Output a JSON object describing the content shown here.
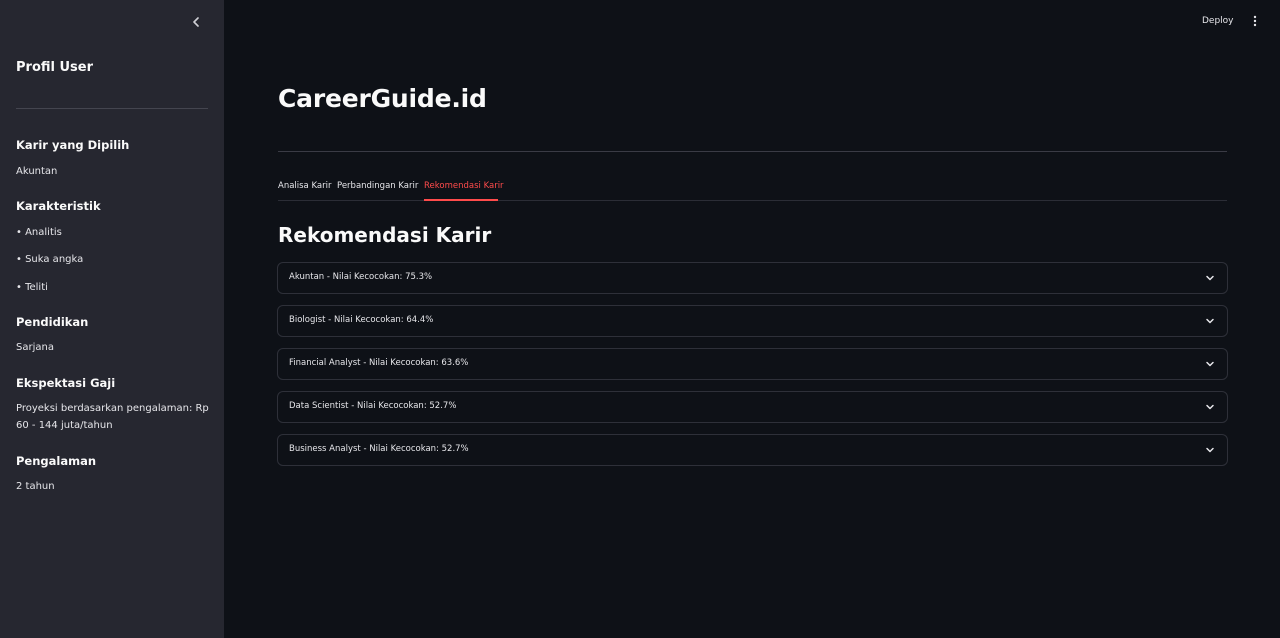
{
  "sidebar": {
    "title": "Profil User",
    "sections": [
      {
        "heading": "Karir yang Dipilih",
        "items": [
          "Akuntan"
        ]
      },
      {
        "heading": "Karakteristik",
        "items": [
          "• Analitis",
          "• Suka angka",
          "• Teliti"
        ]
      },
      {
        "heading": "Pendidikan",
        "items": [
          "Sarjana"
        ]
      },
      {
        "heading": "Ekspektasi Gaji",
        "items": [
          "Proyeksi berdasarkan pengalaman: Rp 60 - 144 juta/tahun"
        ]
      },
      {
        "heading": "Pengalaman",
        "items": [
          "2 tahun"
        ]
      }
    ]
  },
  "toolbar": {
    "deploy_label": "Deploy"
  },
  "main": {
    "app_title": "CareerGuide.id",
    "tabs": [
      {
        "label": "Analisa Karir",
        "active": false
      },
      {
        "label": "Perbandingan Karir",
        "active": false
      },
      {
        "label": "Rekomendasi Karir",
        "active": true
      }
    ],
    "section_title": "Rekomendasi Karir",
    "recommendations": [
      {
        "label": "Akuntan - Nilai Kecocokan: 75.3%",
        "score": 75.3
      },
      {
        "label": "Biologist - Nilai Kecocokan: 64.4%",
        "score": 64.4
      },
      {
        "label": "Financial Analyst - Nilai Kecocokan: 63.6%",
        "score": 63.6
      },
      {
        "label": "Data Scientist - Nilai Kecocokan: 52.7%",
        "score": 52.7
      },
      {
        "label": "Business Analyst - Nilai Kecocokan: 52.7%",
        "score": 52.7
      }
    ]
  },
  "colors": {
    "background": "#0e1117",
    "sidebar_bg": "#262730",
    "accent": "#ff4b4b",
    "text": "#fafafa"
  },
  "icons": {
    "collapse": "chevron-left-icon",
    "menu": "kebab-menu-icon",
    "expand": "chevron-down-icon"
  }
}
